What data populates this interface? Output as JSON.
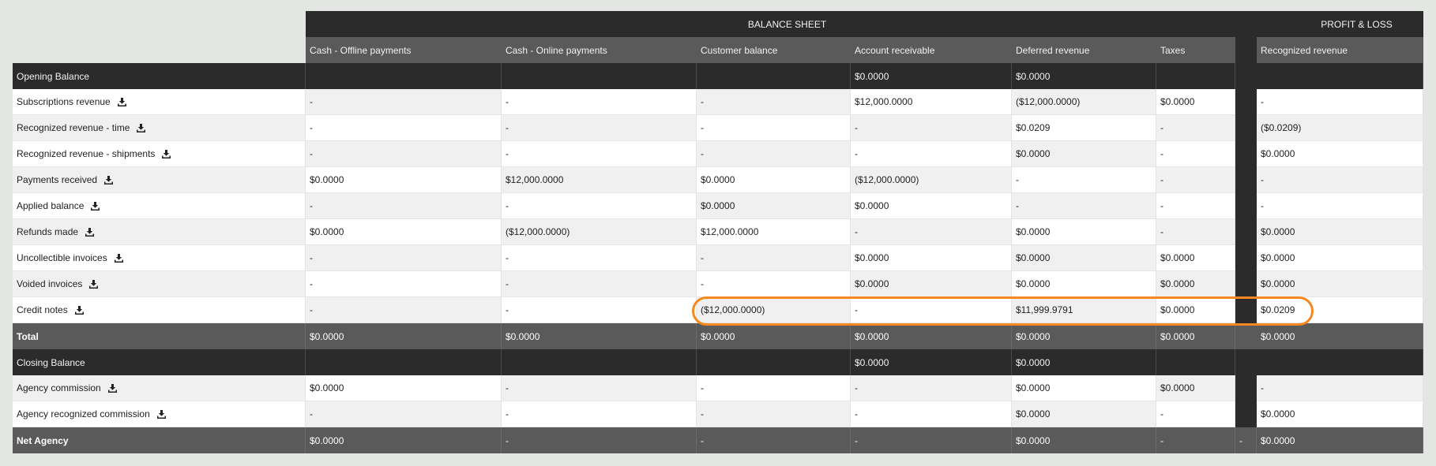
{
  "header": {
    "group_balance_sheet": "BALANCE SHEET",
    "group_profit_loss": "PROFIT & LOSS",
    "columns": [
      "Cash - Offline payments",
      "Cash - Online payments",
      "Customer balance",
      "Account receivable",
      "Deferred revenue",
      "Taxes",
      "Recognized revenue"
    ]
  },
  "rows": [
    {
      "label": "Opening Balance",
      "style": "dark",
      "download": false,
      "cells": [
        "",
        "",
        "",
        "$0.0000",
        "$0.0000",
        "",
        "",
        ""
      ]
    },
    {
      "label": "Subscriptions revenue",
      "style": "body",
      "download": true,
      "cells": [
        "-",
        "-",
        "-",
        "$12,000.0000",
        "($12,000.0000)",
        "$0.0000",
        "",
        "-"
      ]
    },
    {
      "label": "Recognized revenue - time",
      "style": "body",
      "download": true,
      "cells": [
        "-",
        "-",
        "-",
        "-",
        "$0.0209",
        "-",
        "",
        "($0.0209)"
      ]
    },
    {
      "label": "Recognized revenue - shipments",
      "style": "body",
      "download": true,
      "cells": [
        "-",
        "-",
        "-",
        "-",
        "$0.0000",
        "-",
        "",
        "$0.0000"
      ]
    },
    {
      "label": "Payments received",
      "style": "body",
      "download": true,
      "cells": [
        "$0.0000",
        "$12,000.0000",
        "$0.0000",
        "($12,000.0000)",
        "-",
        "-",
        "",
        "-"
      ]
    },
    {
      "label": "Applied balance",
      "style": "body",
      "download": true,
      "cells": [
        "-",
        "-",
        "$0.0000",
        "$0.0000",
        "-",
        "-",
        "",
        "-"
      ]
    },
    {
      "label": "Refunds made",
      "style": "body",
      "download": true,
      "cells": [
        "$0.0000",
        "($12,000.0000)",
        "$12,000.0000",
        "-",
        "$0.0000",
        "-",
        "",
        "$0.0000"
      ]
    },
    {
      "label": "Uncollectible invoices",
      "style": "body",
      "download": true,
      "cells": [
        "-",
        "-",
        "-",
        "$0.0000",
        "$0.0000",
        "$0.0000",
        "",
        "$0.0000"
      ]
    },
    {
      "label": "Voided invoices",
      "style": "body",
      "download": true,
      "cells": [
        "-",
        "-",
        "-",
        "$0.0000",
        "$0.0000",
        "$0.0000",
        "",
        "$0.0000"
      ]
    },
    {
      "label": "Credit notes",
      "style": "body",
      "download": true,
      "cells": [
        "-",
        "-",
        "($12,000.0000)",
        "-",
        "$11,999.9791",
        "$0.0000",
        "",
        "$0.0209"
      ]
    },
    {
      "label": "Total",
      "style": "total",
      "download": false,
      "cells": [
        "$0.0000",
        "$0.0000",
        "$0.0000",
        "$0.0000",
        "$0.0000",
        "$0.0000",
        "",
        "$0.0000"
      ]
    },
    {
      "label": "Closing Balance",
      "style": "dark",
      "download": false,
      "cells": [
        "",
        "",
        "",
        "$0.0000",
        "$0.0000",
        "",
        "",
        ""
      ]
    },
    {
      "label": "Agency commission",
      "style": "body",
      "download": true,
      "cells": [
        "$0.0000",
        "-",
        "-",
        "-",
        "$0.0000",
        "$0.0000",
        "",
        "-"
      ]
    },
    {
      "label": "Agency recognized commission",
      "style": "body",
      "download": true,
      "cells": [
        "-",
        "-",
        "-",
        "-",
        "$0.0000",
        "-",
        "",
        "$0.0000"
      ]
    },
    {
      "label": "Net Agency",
      "style": "total",
      "download": false,
      "cells": [
        "$0.0000",
        "-",
        "-",
        "-",
        "$0.0000",
        "-",
        "-",
        "$0.0000"
      ]
    }
  ],
  "highlight": {
    "row": "Credit notes",
    "color": "#f5891f"
  },
  "colors": {
    "dark": "#2b2b2b",
    "mid": "#5a5a5a",
    "accent": "#f5891f"
  }
}
